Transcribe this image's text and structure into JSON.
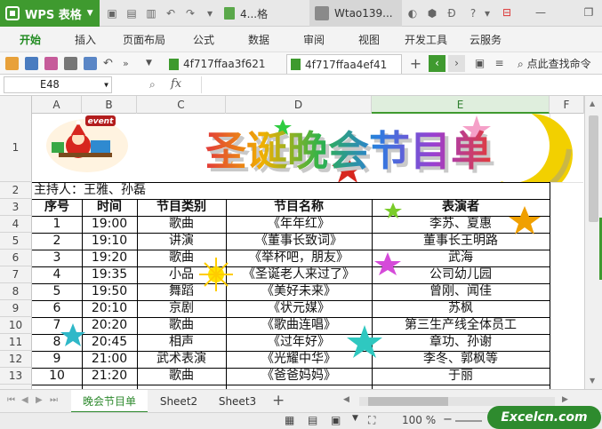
{
  "titlebar": {
    "app_name": "WPS 表格",
    "doc_tab": "4...格",
    "user": "Wtao139...",
    "icons": [
      "sun-icon",
      "shield-icon",
      "dollar-icon",
      "help-icon",
      "chevron-down-icon",
      "minimize-icon",
      "maximize-icon",
      "close-icon"
    ]
  },
  "menu": {
    "items": [
      "开始",
      "插入",
      "页面布局",
      "公式",
      "数据",
      "审阅",
      "视图",
      "开发工具",
      "云服务"
    ]
  },
  "toolbar": {
    "file_tabs": [
      "4f717ffaa3f621",
      "4f717ffaa4ef41"
    ],
    "search_cmd": "点此查找命令",
    "add_label": "+"
  },
  "formula_bar": {
    "name_box": "E48",
    "fx_label": "fx",
    "formula": ""
  },
  "grid": {
    "columns": [
      "A",
      "B",
      "C",
      "D",
      "E",
      "F"
    ],
    "rows": [
      "1",
      "2",
      "3",
      "4",
      "5",
      "6",
      "7",
      "8",
      "9",
      "10",
      "11",
      "12",
      "13"
    ],
    "selected_column": "E",
    "banner_title": "圣诞晚会节目单",
    "banner_badge": "event",
    "host": "主持人：王雅、孙磊",
    "headers": [
      "序号",
      "时间",
      "节目类别",
      "节目名称",
      "表演者"
    ],
    "table": [
      [
        "1",
        "19:00",
        "歌曲",
        "《年年红》",
        "李苏、夏惠"
      ],
      [
        "2",
        "19:10",
        "讲演",
        "《董事长致词》",
        "董事长王明路"
      ],
      [
        "3",
        "19:20",
        "歌曲",
        "《举杯吧，朋友》",
        "武海"
      ],
      [
        "4",
        "19:35",
        "小品",
        "《圣诞老人来过了》",
        "公司幼儿园"
      ],
      [
        "5",
        "19:50",
        "舞蹈",
        "《美好未来》",
        "曾刚、闻佳"
      ],
      [
        "6",
        "20:10",
        "京剧",
        "《状元媒》",
        "苏枫"
      ],
      [
        "7",
        "20:20",
        "歌曲",
        "《歌曲连唱》",
        "第三生产线全体员工"
      ],
      [
        "8",
        "20:45",
        "相声",
        "《过年好》",
        "章功、孙谢"
      ],
      [
        "9",
        "21:00",
        "武术表演",
        "《光耀中华》",
        "李冬、郭枫等"
      ],
      [
        "10",
        "21:20",
        "歌曲",
        "《爸爸妈妈》",
        "于丽"
      ]
    ]
  },
  "sheets": {
    "tabs": [
      "晚会节目单",
      "Sheet2",
      "Sheet3"
    ],
    "active": "晚会节目单",
    "add_label": "+"
  },
  "status": {
    "zoom": "100 %",
    "zoom_minus": "−"
  },
  "watermark": "Excelcn.com",
  "colors": {
    "accent": "#3f9a2f",
    "title_bar": "#e8e8e8"
  }
}
